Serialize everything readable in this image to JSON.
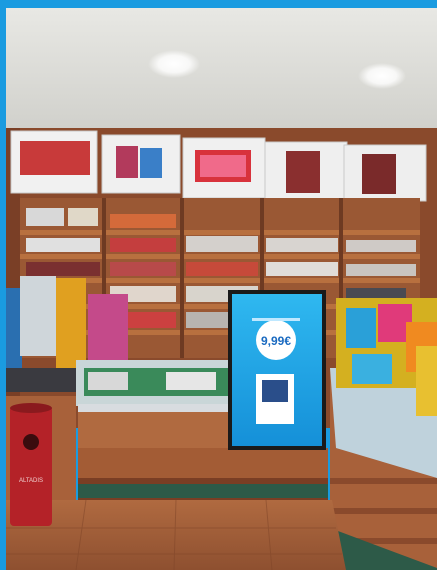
{
  "image": {
    "subject": "tobacco-shop-interior",
    "border_color": "#1a9be0"
  },
  "display_screen": {
    "price_text": "9,99€"
  },
  "bin": {
    "brand_text": "ALTADIS"
  },
  "colors": {
    "ceiling": "#dcdcd8",
    "wood": "#a8613a",
    "wood_dark": "#6e3a22",
    "floor": "#a0603a",
    "screen": "#1ea7e8",
    "bin": "#b42228"
  }
}
